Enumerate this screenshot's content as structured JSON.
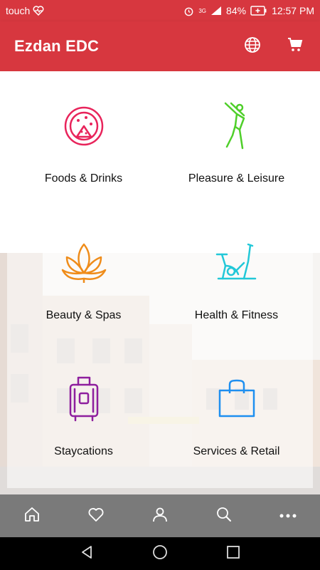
{
  "status_bar": {
    "carrier": "touch",
    "battery": "84%",
    "time": "12:57 PM",
    "network": "3G",
    "icons": [
      "heart-monitor-icon",
      "alarm-icon",
      "signal-icon",
      "battery-charging-icon"
    ]
  },
  "app_bar": {
    "title": "Ezdan EDC",
    "actions": [
      "globe-icon",
      "cart-icon"
    ],
    "color": "#d7373f"
  },
  "categories": [
    {
      "label": "Foods & Drinks",
      "icon": "pizza-icon",
      "color": "#e8245b"
    },
    {
      "label": "Pleasure & Leisure",
      "icon": "golfer-icon",
      "color": "#4fcf2a"
    },
    {
      "label": "Beauty & Spas",
      "icon": "lotus-icon",
      "color": "#ef8c1a"
    },
    {
      "label": "Health & Fitness",
      "icon": "exercise-bike-icon",
      "color": "#22c8d8"
    },
    {
      "label": "Staycations",
      "icon": "luggage-icon",
      "color": "#8e1f9e"
    },
    {
      "label": "Services & Retail",
      "icon": "shopping-bag-icon",
      "color": "#1e8ff0"
    }
  ],
  "bottom_nav": [
    "home-icon",
    "heart-icon",
    "profile-icon",
    "search-icon",
    "more-icon"
  ],
  "system_nav": [
    "back-icon",
    "home-circle-icon",
    "recents-icon"
  ]
}
